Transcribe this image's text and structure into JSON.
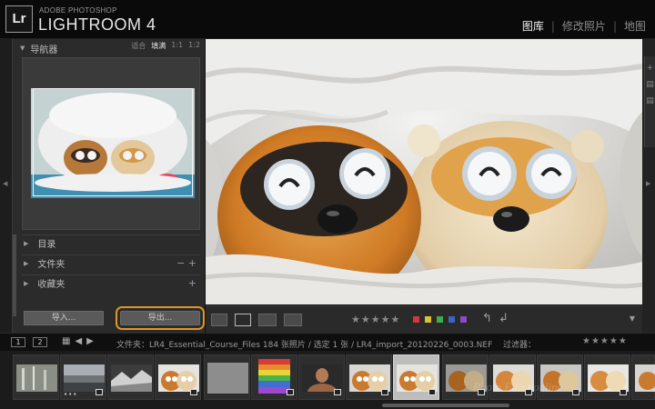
{
  "app": {
    "logo": "Lr",
    "brand_small": "ADOBE PHOTOSHOP",
    "brand_big": "LIGHTROOM 4"
  },
  "modules": [
    {
      "label": "图库",
      "active": true
    },
    {
      "label": "修改照片",
      "active": false
    },
    {
      "label": "地图",
      "active": false
    }
  ],
  "navigator": {
    "title": "导航器",
    "options": [
      "适合",
      "填满",
      "1:1",
      "1:2"
    ],
    "selected_option": "填满"
  },
  "left_sections": [
    {
      "label": "目录",
      "action": ""
    },
    {
      "label": "文件夹",
      "action": "− +"
    },
    {
      "label": "收藏夹",
      "action": "+"
    }
  ],
  "buttons": {
    "import": "导入...",
    "export": "导出..."
  },
  "toolbar": {
    "stars": "★★★★★",
    "colors": [
      "#d23a3a",
      "#d8c430",
      "#3fae45",
      "#3b63c8",
      "#8a4bc4"
    ]
  },
  "filmstrip_header": {
    "page1": "1",
    "page2": "2",
    "source": "文件夹：LR4_Essential_Course_Files",
    "count": "184 张照片 / 选定 1 张 / LR4_import_20120226_0003.NEF",
    "filter_label": "过滤器：",
    "stars": "★★★★★"
  },
  "thumb_dots": "•••",
  "watermark": "Photo.Ellinnonline"
}
